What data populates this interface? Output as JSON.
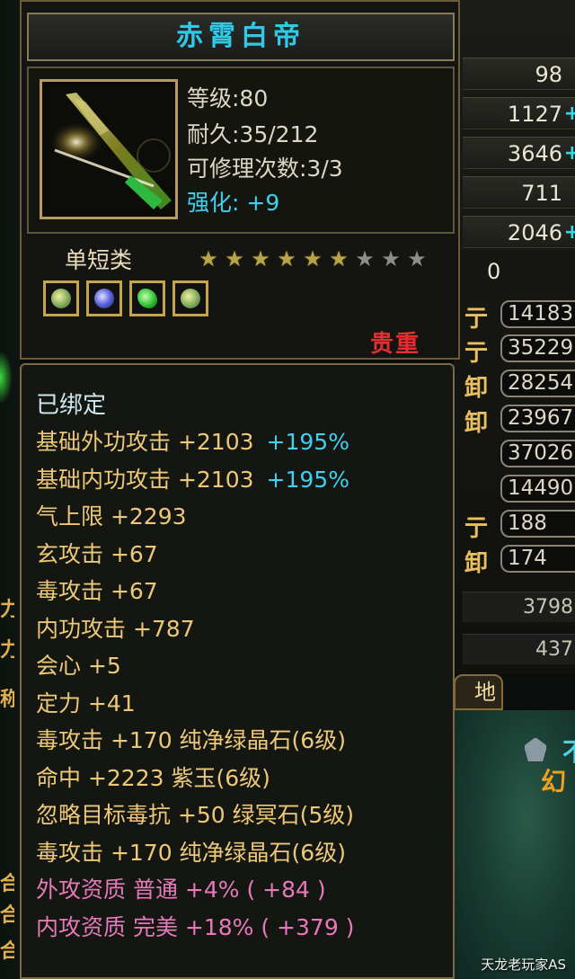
{
  "item": {
    "name": "赤霄白帝",
    "level": "等级:80",
    "durability": "耐久:35/212",
    "repairs": "可修理次数:3/3",
    "enhance_label": "强化:",
    "enhance_value": "+9",
    "category": "单短类",
    "stars_filled": 6,
    "stars_total": 9,
    "gems": [
      "gem-green-jade",
      "gem-purple",
      "gem-green-crystal",
      "gem-green-jade"
    ],
    "rarity": "贵重"
  },
  "details": {
    "bound": "已绑定",
    "attributes": [
      {
        "text": "基础外功攻击  +2103",
        "pct": "+195%",
        "style": "gold"
      },
      {
        "text": "基础内功攻击  +2103",
        "pct": "+195%",
        "style": "gold"
      },
      {
        "text": "气上限  +2293",
        "pct": "",
        "style": "gold"
      },
      {
        "text": "玄攻击  +67",
        "pct": "",
        "style": "gold"
      },
      {
        "text": "毒攻击  +67",
        "pct": "",
        "style": "gold"
      },
      {
        "text": "内功攻击  +787",
        "pct": "",
        "style": "gold"
      },
      {
        "text": "会心  +5",
        "pct": "",
        "style": "gold"
      },
      {
        "text": "定力  +41",
        "pct": "",
        "style": "gold"
      },
      {
        "text": "毒攻击  +170  纯净绿晶石(6级)",
        "pct": "",
        "style": "light"
      },
      {
        "text": "命中  +2223  紫玉(6级)",
        "pct": "",
        "style": "light"
      },
      {
        "text": "忽略目标毒抗  +50  绿冥石(5级)",
        "pct": "",
        "style": "light"
      },
      {
        "text": "毒攻击  +170  纯净绿晶石(6级)",
        "pct": "",
        "style": "light"
      },
      {
        "text": "外攻资质   普通  +4%  ( +84 )",
        "pct": "",
        "style": "pink"
      },
      {
        "text": "内攻资质   完美  +18% ( +379 )",
        "pct": "",
        "style": "pink"
      }
    ]
  },
  "background_panel": {
    "stats": [
      "98",
      "1127",
      "3646",
      "711",
      "2046",
      "0"
    ],
    "rows": [
      {
        "key": "亍:",
        "value": "14183"
      },
      {
        "key": "亍:",
        "value": "35229"
      },
      {
        "key": "卸:",
        "value": "28254"
      },
      {
        "key": "卸:",
        "value": "23967"
      },
      {
        "key": "",
        "value": "37026"
      },
      {
        "key": "",
        "value": "14490"
      },
      {
        "key": "亍:",
        "value": "188"
      },
      {
        "key": "卸:",
        "value": "174"
      }
    ],
    "wide": [
      "3798",
      "437"
    ],
    "tab": "地",
    "map_text": "幻",
    "map_text2": "不"
  },
  "left_edge": [
    "力",
    "力",
    "称",
    "合",
    "合",
    "合"
  ],
  "watermark": "天龙老玩家AS",
  "colors": {
    "gold": "#ecc878",
    "cyan": "#3fd0f0",
    "pink": "#e67ab8",
    "red": "#e23030"
  }
}
